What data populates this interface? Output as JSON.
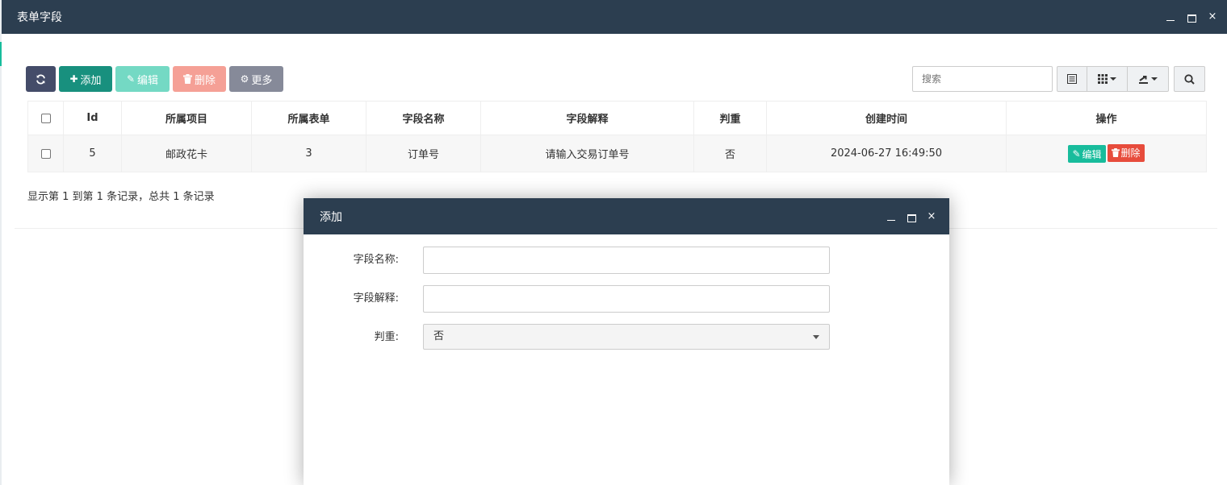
{
  "window": {
    "title": "表单字段",
    "controls": {
      "minimize": "minimize-icon",
      "maximize": "maximize-icon",
      "close": "×"
    }
  },
  "toolbar": {
    "refresh_icon": "refresh-icon",
    "add_label": "添加",
    "edit_label": "编辑",
    "delete_label": "删除",
    "more_label": "更多"
  },
  "search": {
    "placeholder": "搜索"
  },
  "table": {
    "columns": [
      "Id",
      "所属项目",
      "所属表单",
      "字段名称",
      "字段解释",
      "判重",
      "创建时间",
      "操作"
    ],
    "rows": [
      {
        "id": "5",
        "project": "邮政花卡",
        "form": "3",
        "field_name": "订单号",
        "field_desc": "请输入交易订单号",
        "dedupe": "否",
        "created": "2024-06-27 16:49:50",
        "edit_label": "编辑",
        "delete_label": "删除"
      }
    ]
  },
  "pagination": {
    "info": "显示第 1 到第 1 条记录，总共 1 条记录"
  },
  "modal": {
    "title": "添加",
    "close": "×",
    "fields": [
      {
        "label": "字段名称:",
        "value": ""
      },
      {
        "label": "字段解释:",
        "value": ""
      },
      {
        "label": "判重:",
        "value": "否"
      }
    ]
  },
  "colors": {
    "titlebar": "#2c3e50",
    "accent": "#18bc9c",
    "danger": "#e74c3c"
  }
}
